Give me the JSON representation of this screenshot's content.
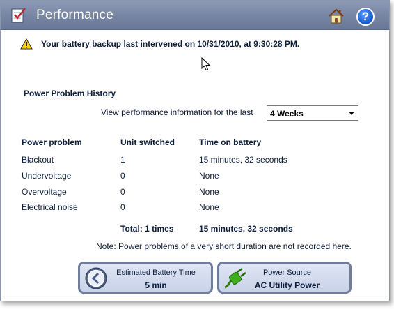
{
  "window": {
    "title": "Performance"
  },
  "alert": {
    "message": "Your battery backup last intervened on 10/31/2010, at 9:30:28 PM."
  },
  "history": {
    "section_title": "Power Problem History",
    "period_label": "View performance information for the last",
    "period_selected": "4 Weeks",
    "columns": [
      "Power problem",
      "Unit switched",
      "Time on battery"
    ],
    "rows": [
      {
        "problem": "Blackout",
        "switched": "1",
        "time": "15 minutes, 32 seconds"
      },
      {
        "problem": "Undervoltage",
        "switched": "0",
        "time": "None"
      },
      {
        "problem": "Overvoltage",
        "switched": "0",
        "time": "None"
      },
      {
        "problem": "Electrical noise",
        "switched": "0",
        "time": "None"
      }
    ],
    "total_label": "Total:  1 times",
    "total_time": "15 minutes, 32 seconds",
    "note": "Note: Power problems of a very short duration are not recorded here."
  },
  "battery_panel": {
    "label": "Estimated Battery Time",
    "value": "5 min",
    "icon": "clock-back-icon"
  },
  "power_panel": {
    "label": "Power Source",
    "value": "AC Utility Power",
    "icon": "power-plug-icon"
  },
  "colors": {
    "titlebar": "#7a88a6",
    "panel_border": "#6f7c9c",
    "text": "#0c1d3a",
    "plug_green": "#3fae1c"
  }
}
